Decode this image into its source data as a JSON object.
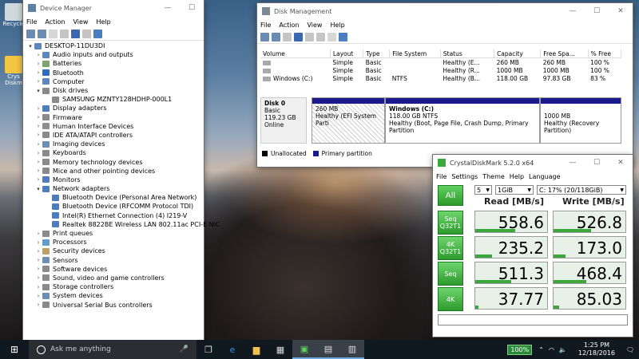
{
  "desktop": {
    "icons": [
      {
        "label": "Recycle",
        "icon": "recycle-bin-icon"
      },
      {
        "label": "Crys Diskm",
        "icon": "crystaldiskmark-shortcut-icon"
      }
    ]
  },
  "device_manager": {
    "title": "Device Manager",
    "menu": [
      "File",
      "Action",
      "View",
      "Help"
    ],
    "root": "DESKTOP-11DU3DI",
    "tree": [
      {
        "label": "Audio inputs and outputs",
        "expanded": false
      },
      {
        "label": "Batteries",
        "expanded": false
      },
      {
        "label": "Bluetooth",
        "expanded": false
      },
      {
        "label": "Computer",
        "expanded": false
      },
      {
        "label": "Disk drives",
        "expanded": true,
        "children": [
          "SAMSUNG MZNTY128HDHP-000L1"
        ]
      },
      {
        "label": "Display adapters",
        "expanded": false
      },
      {
        "label": "Firmware",
        "expanded": false
      },
      {
        "label": "Human Interface Devices",
        "expanded": false
      },
      {
        "label": "IDE ATA/ATAPI controllers",
        "expanded": false
      },
      {
        "label": "Imaging devices",
        "expanded": false
      },
      {
        "label": "Keyboards",
        "expanded": false
      },
      {
        "label": "Memory technology devices",
        "expanded": false
      },
      {
        "label": "Mice and other pointing devices",
        "expanded": false
      },
      {
        "label": "Monitors",
        "expanded": false
      },
      {
        "label": "Network adapters",
        "expanded": true,
        "children": [
          "Bluetooth Device (Personal Area Network)",
          "Bluetooth Device (RFCOMM Protocol TDI)",
          "Intel(R) Ethernet Connection (4) I219-V",
          "Realtek 8822BE Wireless LAN 802.11ac PCI-E NIC"
        ]
      },
      {
        "label": "Print queues",
        "expanded": false
      },
      {
        "label": "Processors",
        "expanded": false
      },
      {
        "label": "Security devices",
        "expanded": false
      },
      {
        "label": "Sensors",
        "expanded": false
      },
      {
        "label": "Software devices",
        "expanded": false
      },
      {
        "label": "Sound, video and game controllers",
        "expanded": false
      },
      {
        "label": "Storage controllers",
        "expanded": false
      },
      {
        "label": "System devices",
        "expanded": false
      },
      {
        "label": "Universal Serial Bus controllers",
        "expanded": false
      }
    ]
  },
  "disk_management": {
    "title": "Disk Management",
    "menu": [
      "File",
      "Action",
      "View",
      "Help"
    ],
    "columns": [
      "Volume",
      "Layout",
      "Type",
      "File System",
      "Status",
      "Capacity",
      "Free Spa...",
      "% Free"
    ],
    "rows": [
      [
        "",
        "Simple",
        "Basic",
        "",
        "Healthy (E...",
        "260 MB",
        "260 MB",
        "100 %"
      ],
      [
        "",
        "Simple",
        "Basic",
        "",
        "Healthy (R...",
        "1000 MB",
        "1000 MB",
        "100 %"
      ],
      [
        "Windows (C:)",
        "Simple",
        "Basic",
        "NTFS",
        "Healthy (B...",
        "118.00 GB",
        "97.83 GB",
        "83 %"
      ]
    ],
    "disk": {
      "name": "Disk 0",
      "type": "Basic",
      "size": "119.23 GB",
      "status": "Online"
    },
    "partitions": [
      {
        "title": "",
        "size": "260 MB",
        "status": "Healthy (EFI System Parti"
      },
      {
        "title": "Windows (C:)",
        "size": "118.00 GB NTFS",
        "status": "Healthy (Boot, Page File, Crash Dump, Primary Partition"
      },
      {
        "title": "",
        "size": "1000 MB",
        "status": "Healthy (Recovery Partition)"
      }
    ],
    "legend": [
      "Unallocated",
      "Primary partition"
    ]
  },
  "crystaldiskmark": {
    "title": "CrystalDiskMark 5.2.0 x64",
    "menu": [
      "File",
      "Settings",
      "Theme",
      "Help",
      "Language"
    ],
    "all_label": "All",
    "count": "5",
    "size": "1GiB",
    "drive": "C: 17% (20/118GiB)",
    "read_header": "Read [MB/s]",
    "write_header": "Write [MB/s]",
    "tests": [
      {
        "line1": "Seq",
        "line2": "Q32T1",
        "read": "558.6",
        "write": "526.8",
        "read_fill": 0.55,
        "write_fill": 0.52
      },
      {
        "line1": "4K",
        "line2": "Q32T1",
        "read": "235.2",
        "write": "173.0",
        "read_fill": 0.23,
        "write_fill": 0.17
      },
      {
        "line1": "Seq",
        "line2": "",
        "read": "511.3",
        "write": "468.4",
        "read_fill": 0.5,
        "write_fill": 0.46
      },
      {
        "line1": "4K",
        "line2": "",
        "read": "37.77",
        "write": "85.03",
        "read_fill": 0.04,
        "write_fill": 0.08
      }
    ],
    "comment": ""
  },
  "taskbar": {
    "search_placeholder": "Ask me anything",
    "battery": "100%",
    "time": "1:25 PM",
    "date": "12/18/2016",
    "apps": [
      "task-view-icon",
      "edge-icon",
      "file-explorer-icon",
      "store-icon",
      "crystaldiskmark-icon",
      "device-manager-icon",
      "disk-management-icon"
    ]
  },
  "colors": {
    "primary_partition": "#1a1a8c",
    "cdm_green": "#3aa83a",
    "taskbar": "#101820"
  }
}
